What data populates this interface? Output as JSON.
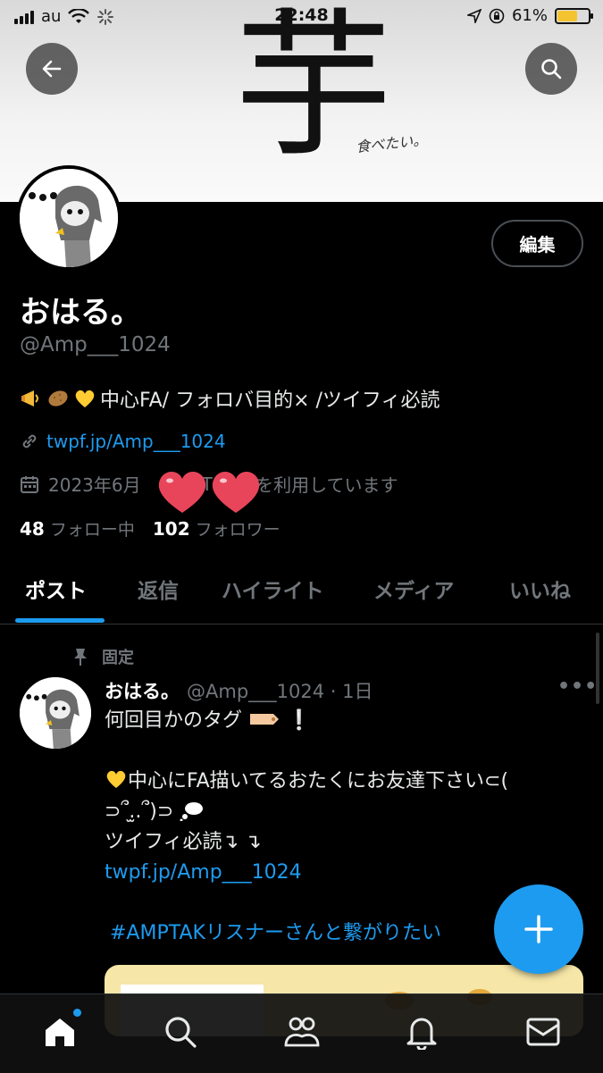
{
  "status_bar": {
    "carrier": "au",
    "time": "22:48",
    "battery": "61%"
  },
  "banner": {
    "kanji": "芋",
    "handwriting": "食べたい。"
  },
  "profile": {
    "name": "おはる。",
    "handle": "@Amp___1024",
    "edit_label": "編集",
    "bio_text": "中心FA/ フォロバ目的× /ツイフィ必読",
    "bio_emojis": [
      "megaphone-icon",
      "potato-icon",
      "yellow-heart-icon"
    ],
    "link": "twpf.jp/Amp___1024",
    "joined_prefix": "2023年6月",
    "joined_suffix": "rを利用しています",
    "joined_hidden": "T",
    "following_count": "48",
    "following_label": "フォロー中",
    "followers_count": "102",
    "followers_label": "フォロワー"
  },
  "tabs": [
    {
      "label": "ポスト",
      "active": true
    },
    {
      "label": "返信",
      "active": false
    },
    {
      "label": "ハイライト",
      "active": false
    },
    {
      "label": "メディア",
      "active": false
    },
    {
      "label": "いいね",
      "active": false
    }
  ],
  "post": {
    "pinned_label": "固定",
    "author_name": "おはる。",
    "author_meta": "@Amp___1024 · 1日",
    "lines": [
      "何回目かのタグ",
      "",
      "中心にFA描いてるおたくにお友達下さい⊂(",
      "⊃՞.̫.՞)⊃",
      "ツイフィ必読↴ ↴",
      "twpf.jp/Amp___1024",
      "",
      "#AMPTAKリスナーさんと繋がりたい"
    ]
  },
  "colors": {
    "accent": "#1d9bf0",
    "background": "#000000",
    "secondary_text": "#71767b",
    "heart": "#e8455a"
  },
  "bottom_nav": [
    "home-icon",
    "search-icon",
    "communities-icon",
    "notifications-icon",
    "messages-icon"
  ]
}
